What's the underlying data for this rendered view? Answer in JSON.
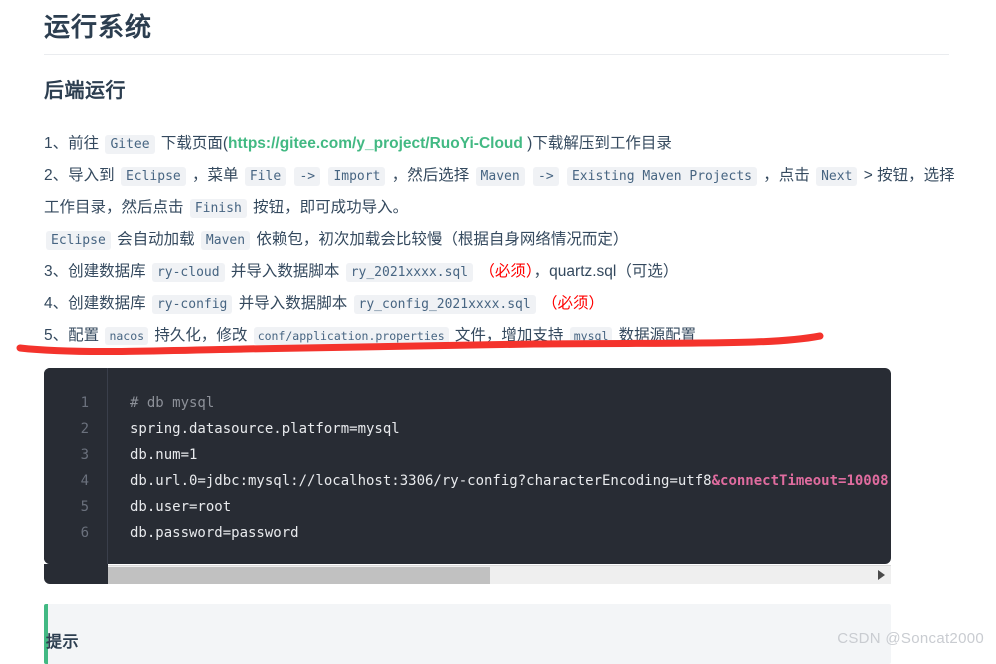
{
  "page": {
    "title": "运行系统",
    "section_title": "后端运行"
  },
  "steps": [
    {
      "index": "1、",
      "parts": [
        {
          "type": "text",
          "value": "前往 "
        },
        {
          "type": "code",
          "value": "Gitee"
        },
        {
          "type": "text",
          "value": " 下载页面("
        },
        {
          "type": "link",
          "value": "https://gitee.com/y_project/RuoYi-Cloud"
        },
        {
          "type": "text",
          "value": " )下载解压到工作目录"
        }
      ]
    },
    {
      "index": "2、",
      "parts": [
        {
          "type": "text",
          "value": "导入到 "
        },
        {
          "type": "code",
          "value": "Eclipse"
        },
        {
          "type": "text",
          "value": " ，菜单 "
        },
        {
          "type": "code",
          "value": "File"
        },
        {
          "type": "text",
          "value": " "
        },
        {
          "type": "code",
          "value": "->"
        },
        {
          "type": "text",
          "value": " "
        },
        {
          "type": "code",
          "value": "Import"
        },
        {
          "type": "text",
          "value": " ，然后选择 "
        },
        {
          "type": "code",
          "value": "Maven"
        },
        {
          "type": "text",
          "value": " "
        },
        {
          "type": "code",
          "value": "->"
        },
        {
          "type": "text",
          "value": " "
        },
        {
          "type": "code",
          "value": "Existing Maven Projects"
        },
        {
          "type": "text",
          "value": " ，点击 "
        },
        {
          "type": "code",
          "value": "Next"
        },
        {
          "type": "text",
          "value": " > 按钮，选择工作目录，然后点击 "
        },
        {
          "type": "code",
          "value": "Finish"
        },
        {
          "type": "text",
          "value": " 按钮，即可成功导入。"
        },
        {
          "type": "break",
          "value": ""
        },
        {
          "type": "code",
          "value": "Eclipse"
        },
        {
          "type": "text",
          "value": " 会自动加载 "
        },
        {
          "type": "code",
          "value": "Maven"
        },
        {
          "type": "text",
          "value": " 依赖包，初次加载会比较慢（根据自身网络情况而定）"
        }
      ]
    },
    {
      "index": "3、",
      "parts": [
        {
          "type": "text",
          "value": "创建数据库 "
        },
        {
          "type": "code",
          "value": "ry-cloud"
        },
        {
          "type": "text",
          "value": " 并导入数据脚本 "
        },
        {
          "type": "code",
          "value": "ry_2021xxxx.sql"
        },
        {
          "type": "text",
          "value": " "
        },
        {
          "type": "req",
          "value": "（必须）"
        },
        {
          "type": "text",
          "value": "，quartz.sql（可选）"
        }
      ]
    },
    {
      "index": "4、",
      "parts": [
        {
          "type": "text",
          "value": "创建数据库 "
        },
        {
          "type": "code",
          "value": "ry-config"
        },
        {
          "type": "text",
          "value": " 并导入数据脚本 "
        },
        {
          "type": "code",
          "value": "ry_config_2021xxxx.sql"
        },
        {
          "type": "text",
          "value": "  "
        },
        {
          "type": "req",
          "value": "（必须）"
        }
      ]
    },
    {
      "index": "5、",
      "parts": [
        {
          "type": "text",
          "value": "配置 "
        },
        {
          "type": "codesm",
          "value": "nacos"
        },
        {
          "type": "text",
          "value": " 持久化，修改 "
        },
        {
          "type": "codesm",
          "value": "conf/application.properties"
        },
        {
          "type": "text",
          "value": " 文件，增加支持 "
        },
        {
          "type": "codesm",
          "value": "mysql"
        },
        {
          "type": "text",
          "value": " 数据源配置"
        }
      ]
    }
  ],
  "annotation": {
    "name": "red-underline-annotation",
    "color": "#f4332c"
  },
  "code_block": {
    "language": "properties",
    "line_numbers": [
      "1",
      "2",
      "3",
      "4",
      "5",
      "6"
    ],
    "lines": [
      [
        {
          "tok": "comment",
          "text": "# db mysql"
        }
      ],
      [
        {
          "tok": "plain",
          "text": "spring.datasource.platform=mysql"
        }
      ],
      [
        {
          "tok": "plain",
          "text": "db.num=1"
        }
      ],
      [
        {
          "tok": "plain",
          "text": "db.url.0=jdbc:mysql://localhost:3306/ry-config?characterEncoding=utf8"
        },
        {
          "tok": "pink",
          "text": "&connectTimeout=10008"
        }
      ],
      [
        {
          "tok": "plain",
          "text": "db.user=root"
        }
      ],
      [
        {
          "tok": "plain",
          "text": "db.password=password"
        }
      ]
    ],
    "scrollbar": {
      "name": "horizontal-scrollbar",
      "thumb_ratio": "0.49",
      "arrow_glyph": "▶"
    }
  },
  "tip": {
    "title": "提示",
    "accent_color": "#42b983"
  },
  "watermark": {
    "text": "CSDN @Soncat2000"
  },
  "colors": {
    "heading": "#2c3e50",
    "body_text": "#34495e",
    "inline_code_bg": "#f0f2f5",
    "inline_code_fg": "#476582",
    "link": "#42b983",
    "required_red": "#ff0000",
    "code_bg": "#282c34",
    "code_pink": "#e06c9f",
    "annotation_red": "#f4332c"
  }
}
